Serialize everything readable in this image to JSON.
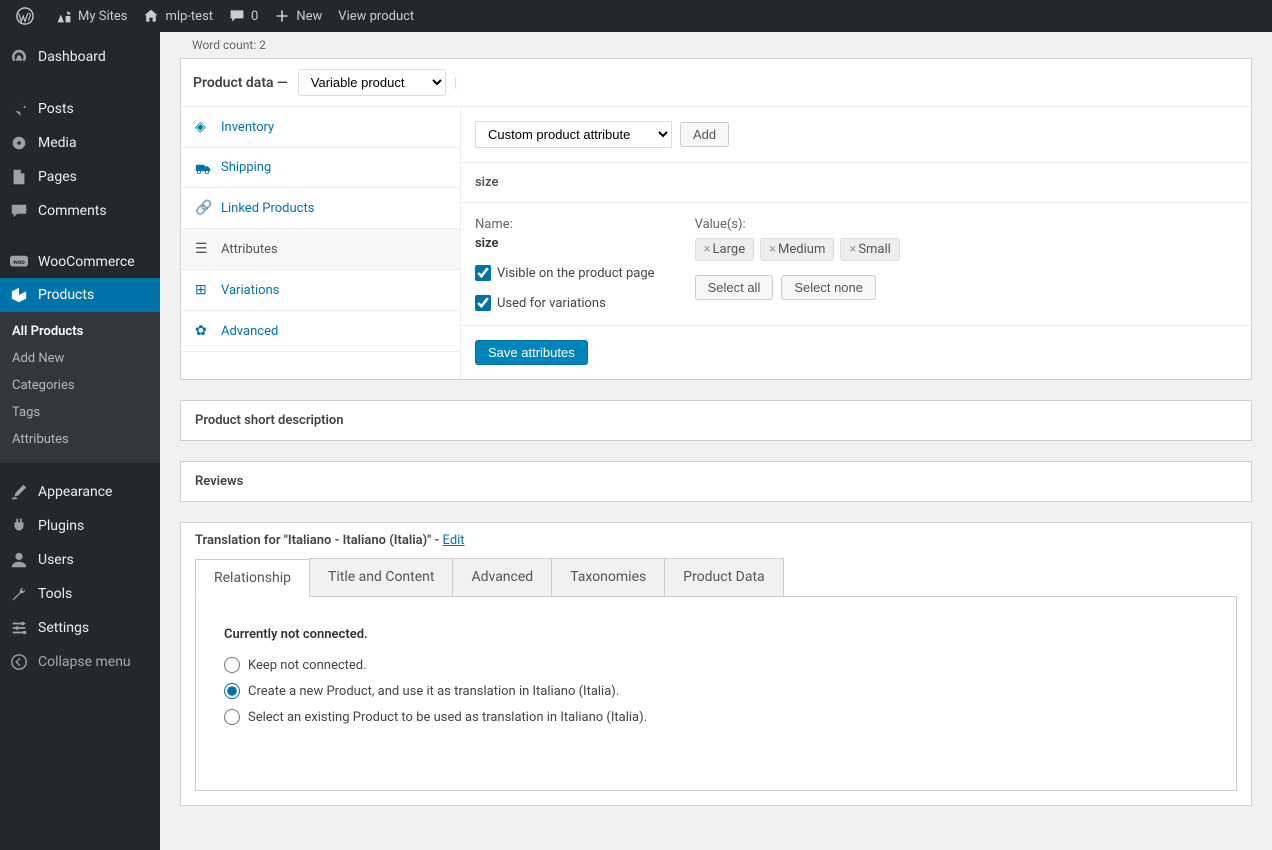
{
  "topbar": {
    "mysites": "My Sites",
    "sitename": "mlp-test",
    "comments": "0",
    "new": "New",
    "viewproduct": "View product"
  },
  "sidebar": {
    "dashboard": "Dashboard",
    "posts": "Posts",
    "media": "Media",
    "pages": "Pages",
    "comments": "Comments",
    "woocommerce": "WooCommerce",
    "products": "Products",
    "products_sub": {
      "all": "All Products",
      "add": "Add New",
      "categories": "Categories",
      "tags": "Tags",
      "attributes": "Attributes"
    },
    "appearance": "Appearance",
    "plugins": "Plugins",
    "users": "Users",
    "tools": "Tools",
    "settings": "Settings",
    "collapse": "Collapse menu"
  },
  "wordcount": "Word count: 2",
  "product_data": {
    "title": "Product data —",
    "type_select": "Variable product",
    "tabs": {
      "inventory": "Inventory",
      "shipping": "Shipping",
      "linked": "Linked Products",
      "attributes": "Attributes",
      "variations": "Variations",
      "advanced": "Advanced"
    },
    "attr_select": "Custom product attribute",
    "add_btn": "Add",
    "attr_name_title": "size",
    "name_label": "Name:",
    "name_value": "size",
    "visible_label": "Visible on the product page",
    "used_label": "Used for variations",
    "values_label": "Value(s):",
    "values": [
      "Large",
      "Medium",
      "Small"
    ],
    "select_all": "Select all",
    "select_none": "Select none",
    "save": "Save attributes"
  },
  "short_desc_title": "Product short description",
  "reviews_title": "Reviews",
  "translation": {
    "title_prefix": "Translation for \"Italiano - Italiano (Italia)\" - ",
    "edit": "Edit",
    "tabs": {
      "relationship": "Relationship",
      "title_content": "Title and Content",
      "advanced": "Advanced",
      "taxonomies": "Taxonomies",
      "product_data": "Product Data"
    },
    "panel_title": "Currently not connected.",
    "opt_keep": "Keep not connected.",
    "opt_create": "Create a new Product, and use it as translation in Italiano (Italia).",
    "opt_select": "Select an existing Product to be used as translation in Italiano (Italia)."
  }
}
